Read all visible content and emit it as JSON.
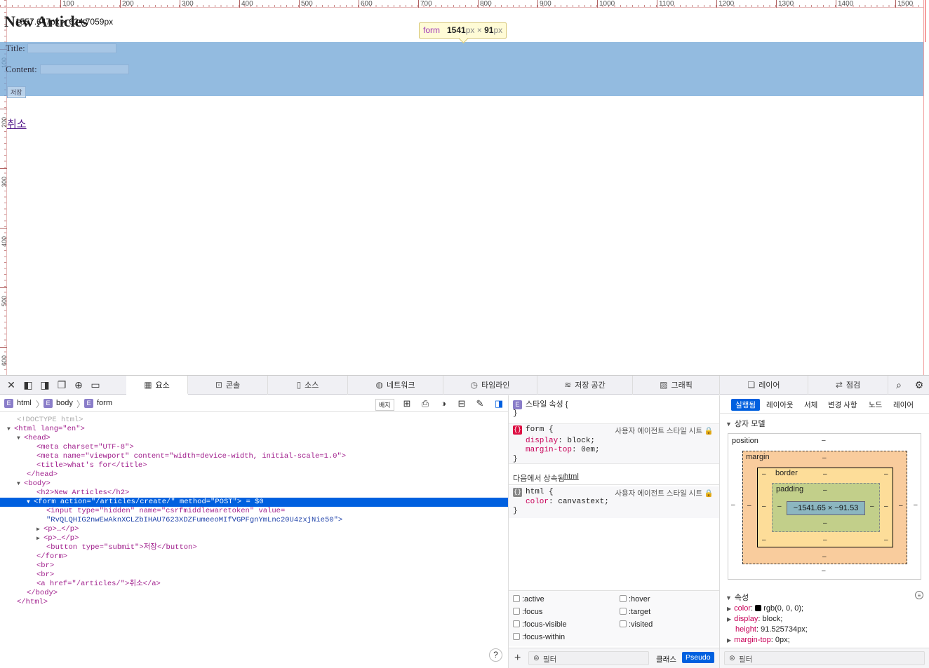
{
  "viewport": {
    "dims_text": "1557.647px × 624.7059px",
    "heading": "New Articles",
    "title_label": "Title:",
    "content_label": "Content:",
    "save_label": "저장",
    "cancel_label": "취소",
    "tooltip": {
      "tag": "form",
      "width": "1541",
      "x": "×",
      "height": "91",
      "unit": "px"
    },
    "ruler_ticks_x": [
      "100",
      "200",
      "300",
      "400",
      "500",
      "600",
      "700",
      "800",
      "900",
      "1000",
      "1100",
      "1200",
      "1300",
      "1400",
      "1500"
    ],
    "ruler_ticks_y": [
      "100",
      "200",
      "300",
      "400",
      "500",
      "600"
    ]
  },
  "devtools": {
    "tabs": [
      "요소",
      "콘솔",
      "소스",
      "네트워크",
      "타임라인",
      "저장 공간",
      "그래픽",
      "레이어",
      "점검"
    ],
    "active_tab": "요소",
    "breadcrumbs": [
      "html",
      "body",
      "form"
    ],
    "badge_label": "배지",
    "tree": [
      {
        "text": "<!DOCTYPE html>"
      },
      {
        "text": "<html lang=\"en\">"
      },
      {
        "text": "<head>"
      },
      {
        "text": "<meta charset=\"UTF-8\">"
      },
      {
        "text": "<meta name=\"viewport\" content=\"width=device-width, initial-scale=1.0\">"
      },
      {
        "text": "<title>what's for</title>"
      },
      {
        "text": "</head>"
      },
      {
        "text": "<body>"
      },
      {
        "text": "<h2>New Articles</h2>"
      },
      {
        "text": "<form action=\"/articles/create/\" method=\"POST\"> = $0"
      },
      {
        "text": "<input type=\"hidden\" name=\"csrfmiddlewaretoken\" value="
      },
      {
        "text": "\"RvQLQHIG2nwEwAknXCLZbIHAU7623XDZFumeeoMIfVGPFgnYmLnc20U4zxjNie50\">"
      },
      {
        "text": "<p>…</p>"
      },
      {
        "text": "<p>…</p>"
      },
      {
        "text": "<button type=\"submit\">저장</button>"
      },
      {
        "text": "</form>"
      },
      {
        "text": "<br>"
      },
      {
        "text": "<br>"
      },
      {
        "text": "<a href=\"/articles/\">취소</a>"
      },
      {
        "text": "</body>"
      },
      {
        "text": "</html>"
      }
    ],
    "rules": {
      "style_attr": "스타일 속성 {",
      "close": "}",
      "form_selector": "form {",
      "ua_source": "사용자 에이전트 스타일 시트",
      "form_props": [
        {
          "name": "display",
          "value": "block;"
        },
        {
          "name": "margin-top",
          "value": "0em;"
        }
      ],
      "inherited_label": "다음에서 상속됨",
      "inherited_from": "html",
      "html_selector": "html {",
      "html_props": [
        {
          "name": "color",
          "value": "canvastext;"
        }
      ],
      "pseudo": [
        ":active",
        ":hover",
        ":focus",
        ":target",
        ":focus-visible",
        ":visited",
        ":focus-within"
      ],
      "filter_placeholder": "필터",
      "class_label": "클래스",
      "pseudo_label": "Pseudo"
    },
    "layout": {
      "tabs": [
        "실행됨",
        "레이아웃",
        "서체",
        "변경 사항",
        "노드",
        "레이어"
      ],
      "active_tab": "실행됨",
      "box_model_title": "상자 모델",
      "position_label": "position",
      "margin_label": "margin",
      "border_label": "border",
      "padding_label": "padding",
      "dash": "–",
      "content_size": "~1541.65 × ~91.53",
      "props_title": "속성",
      "props": [
        {
          "key": "color",
          "value": "rgb(0, 0, 0);"
        },
        {
          "key": "display",
          "value": "block;"
        },
        {
          "key": "height",
          "value": "91.525734px;"
        },
        {
          "key": "margin-top",
          "value": "0px;"
        }
      ],
      "filter_placeholder": "필터"
    }
  }
}
